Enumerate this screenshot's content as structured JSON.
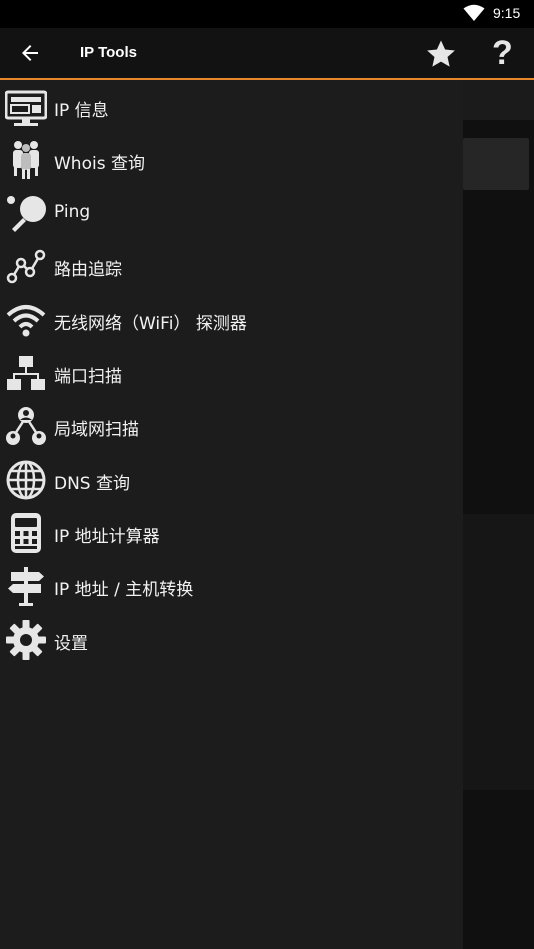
{
  "status_bar": {
    "time": "9:15",
    "wifi_icon": "wifi-icon"
  },
  "app_bar": {
    "title": "IP Tools",
    "back_icon": "arrow-left-icon",
    "favorite_icon": "star-icon",
    "help_icon": "question-mark-icon",
    "help_glyph": "?"
  },
  "colors": {
    "accent": "#e8862a",
    "drawer_bg": "#1c1c1c",
    "page_bg": "#101010",
    "icon": "#e6e6e6"
  },
  "drawer": {
    "items": [
      {
        "label": "IP 信息",
        "icon": "monitor-icon"
      },
      {
        "label": "Whois 查询",
        "icon": "people-icon"
      },
      {
        "label": "Ping",
        "icon": "ping-pong-icon"
      },
      {
        "label": "路由追踪",
        "icon": "route-nodes-icon"
      },
      {
        "label": "无线网络（WiFi） 探测器",
        "icon": "wifi-icon"
      },
      {
        "label": "端口扫描",
        "icon": "network-hierarchy-icon"
      },
      {
        "label": "局域网扫描",
        "icon": "user-network-icon"
      },
      {
        "label": "DNS 查询",
        "icon": "globe-icon"
      },
      {
        "label": "IP 地址计算器",
        "icon": "calculator-icon"
      },
      {
        "label": "IP 地址 / 主机转换",
        "icon": "signpost-icon"
      },
      {
        "label": "设置",
        "icon": "gear-icon"
      }
    ]
  }
}
